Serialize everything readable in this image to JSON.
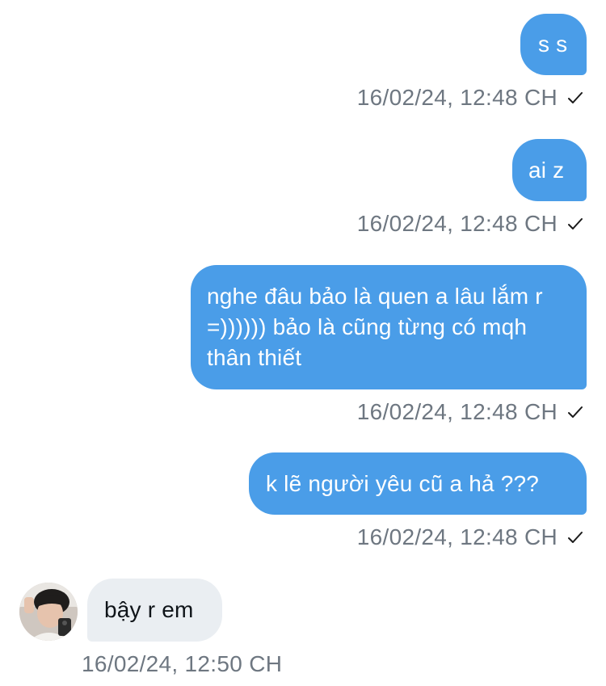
{
  "messages": [
    {
      "direction": "outgoing",
      "text": "s s",
      "timestamp": "16/02/24, 12:48 CH",
      "status_icon": "check-icon"
    },
    {
      "direction": "outgoing",
      "text": "ai z",
      "timestamp": "16/02/24, 12:48 CH",
      "status_icon": "check-icon"
    },
    {
      "direction": "outgoing",
      "text": "nghe đâu bảo là quen a lâu lắm r =)))))) bảo là cũng từng có mqh thân thiết",
      "timestamp": "16/02/24, 12:48 CH",
      "status_icon": "check-icon"
    },
    {
      "direction": "outgoing",
      "text": "k lẽ người yêu cũ a hả ???",
      "timestamp": "16/02/24, 12:48 CH",
      "status_icon": "check-icon"
    },
    {
      "direction": "incoming",
      "text": "bậy r em",
      "timestamp": "16/02/24, 12:50 CH"
    }
  ],
  "colors": {
    "outgoing_bubble": "#4a9de8",
    "incoming_bubble": "#eaeef2",
    "timestamp_text": "#6e7781",
    "incoming_text": "#0f1419"
  }
}
